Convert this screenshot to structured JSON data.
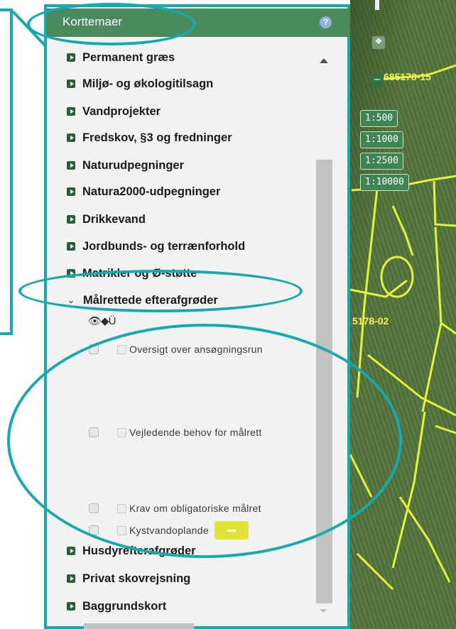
{
  "panel": {
    "title": "Korttemaer",
    "help_icon": "?"
  },
  "layers": [
    {
      "label": "Permanent græs"
    },
    {
      "label": "Miljø- og økologitilsagn"
    },
    {
      "label": "Vandprojekter"
    },
    {
      "label": "Fredskov, §3 og fredninger"
    },
    {
      "label": "Naturudpegninger"
    },
    {
      "label": "Natura2000-udpegninger"
    },
    {
      "label": "Drikkevand"
    },
    {
      "label": "Jordbunds- og terrænforhold"
    },
    {
      "label": "Matrikler og Ø-støtte"
    },
    {
      "label": "Målrettede efterafgrøder"
    },
    {
      "label": "Husdyrefterafgrøder"
    },
    {
      "label": "Privat skovrejsning"
    },
    {
      "label": "Baggrundskort"
    }
  ],
  "sublayer_icons": "👁◆Ü",
  "sublayers": [
    {
      "label": "Oversigt over ansøgningsrun"
    },
    {
      "label": "Vejledende behov for målrett"
    },
    {
      "label": "Krav om obligatoriske målret"
    },
    {
      "label": "Kystvandoplande"
    }
  ],
  "map": {
    "zoom_out": "–",
    "scales": [
      "1:500",
      "1:1000",
      "1:2500",
      "1:10000"
    ],
    "labels": [
      "685178-15",
      "5178-02"
    ]
  },
  "colors": {
    "header": "#4a8a5d",
    "annotation": "#15aab0",
    "swatch": "#e3e337",
    "field_outline": "#e4f23a"
  }
}
